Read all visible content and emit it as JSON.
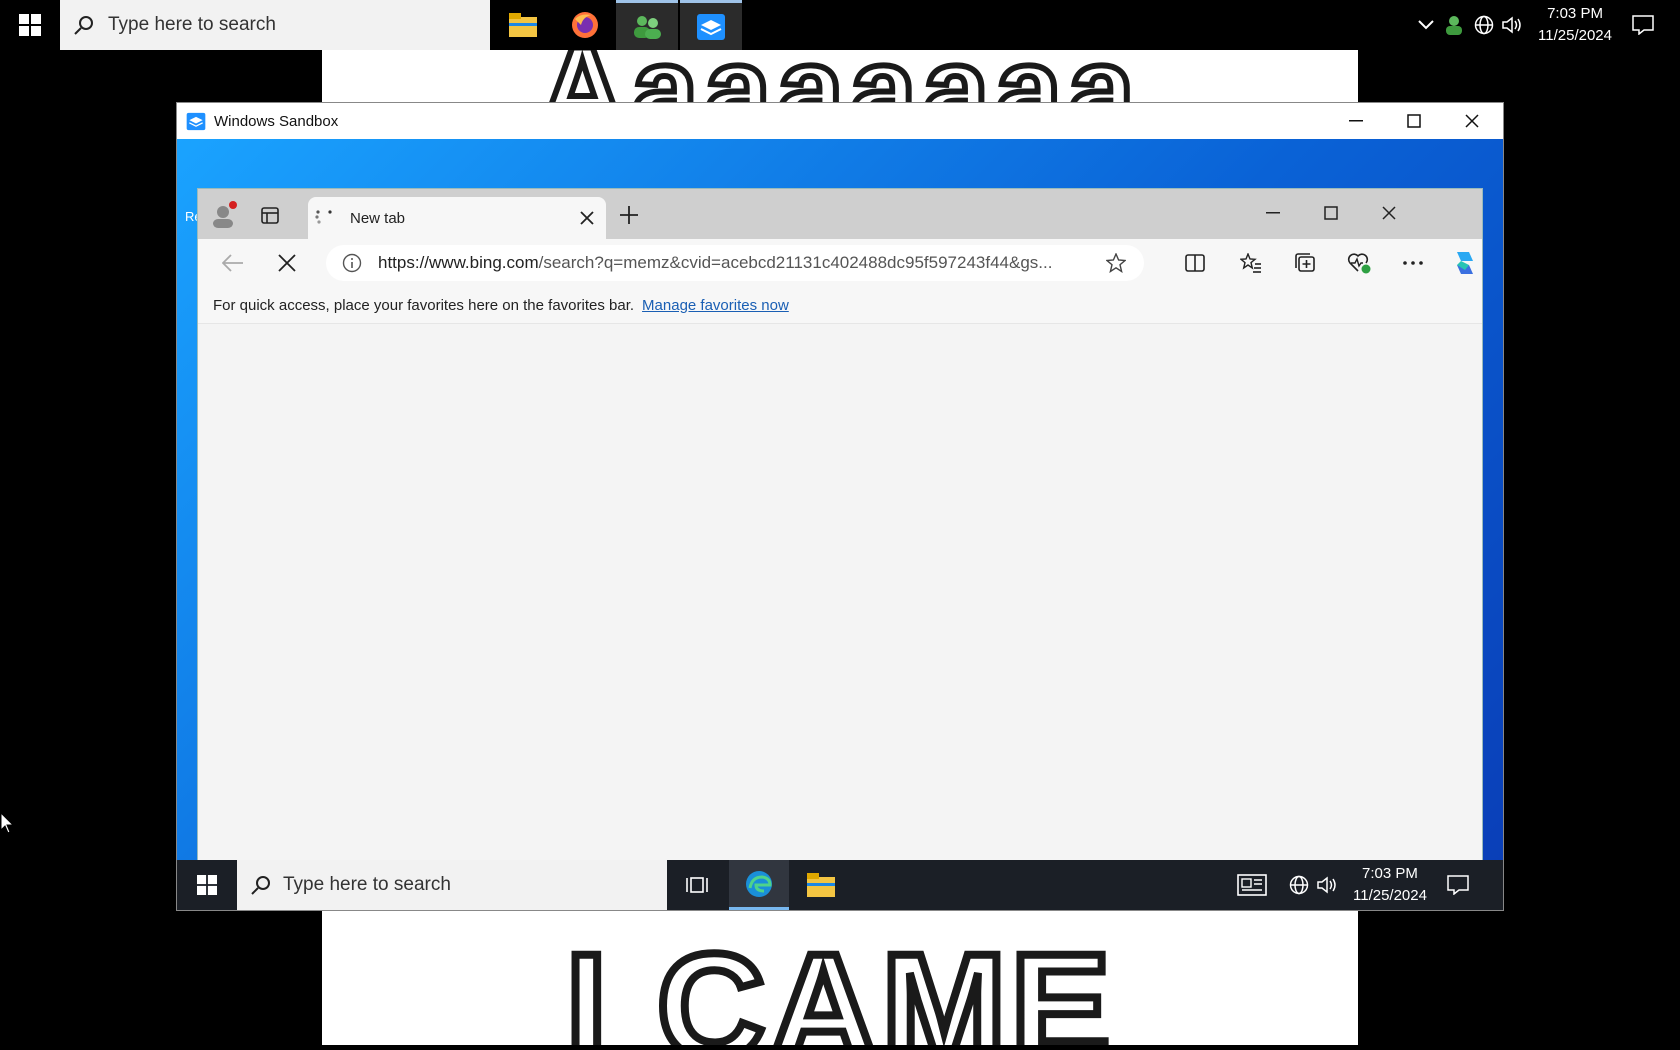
{
  "host_taskbar": {
    "search_placeholder": "Type here to search",
    "apps": [
      "file-explorer",
      "firefox",
      "people",
      "windows-sandbox"
    ],
    "time": "7:03 PM",
    "date": "11/25/2024"
  },
  "meme": {
    "top_text": "Aaaaaaaa",
    "bottom_text": "I CAME"
  },
  "sandbox": {
    "title": "Windows Sandbox",
    "desktop_icon_label": "Re"
  },
  "edge": {
    "tab_title": "New tab",
    "url_host": "https://www.bing.com",
    "url_path": "/search?q=memz&cvid=acebcd21131c402488dc95f597243f44&gs...",
    "favbar_text": "For quick access, place your favorites here on the favorites bar.",
    "favbar_link": "Manage favorites now"
  },
  "sandbox_taskbar": {
    "search_placeholder": "Type here to search",
    "time": "7:03 PM",
    "date": "11/25/2024"
  },
  "colors": {
    "accent": "#0a62d6",
    "link": "#1a5fb4"
  }
}
